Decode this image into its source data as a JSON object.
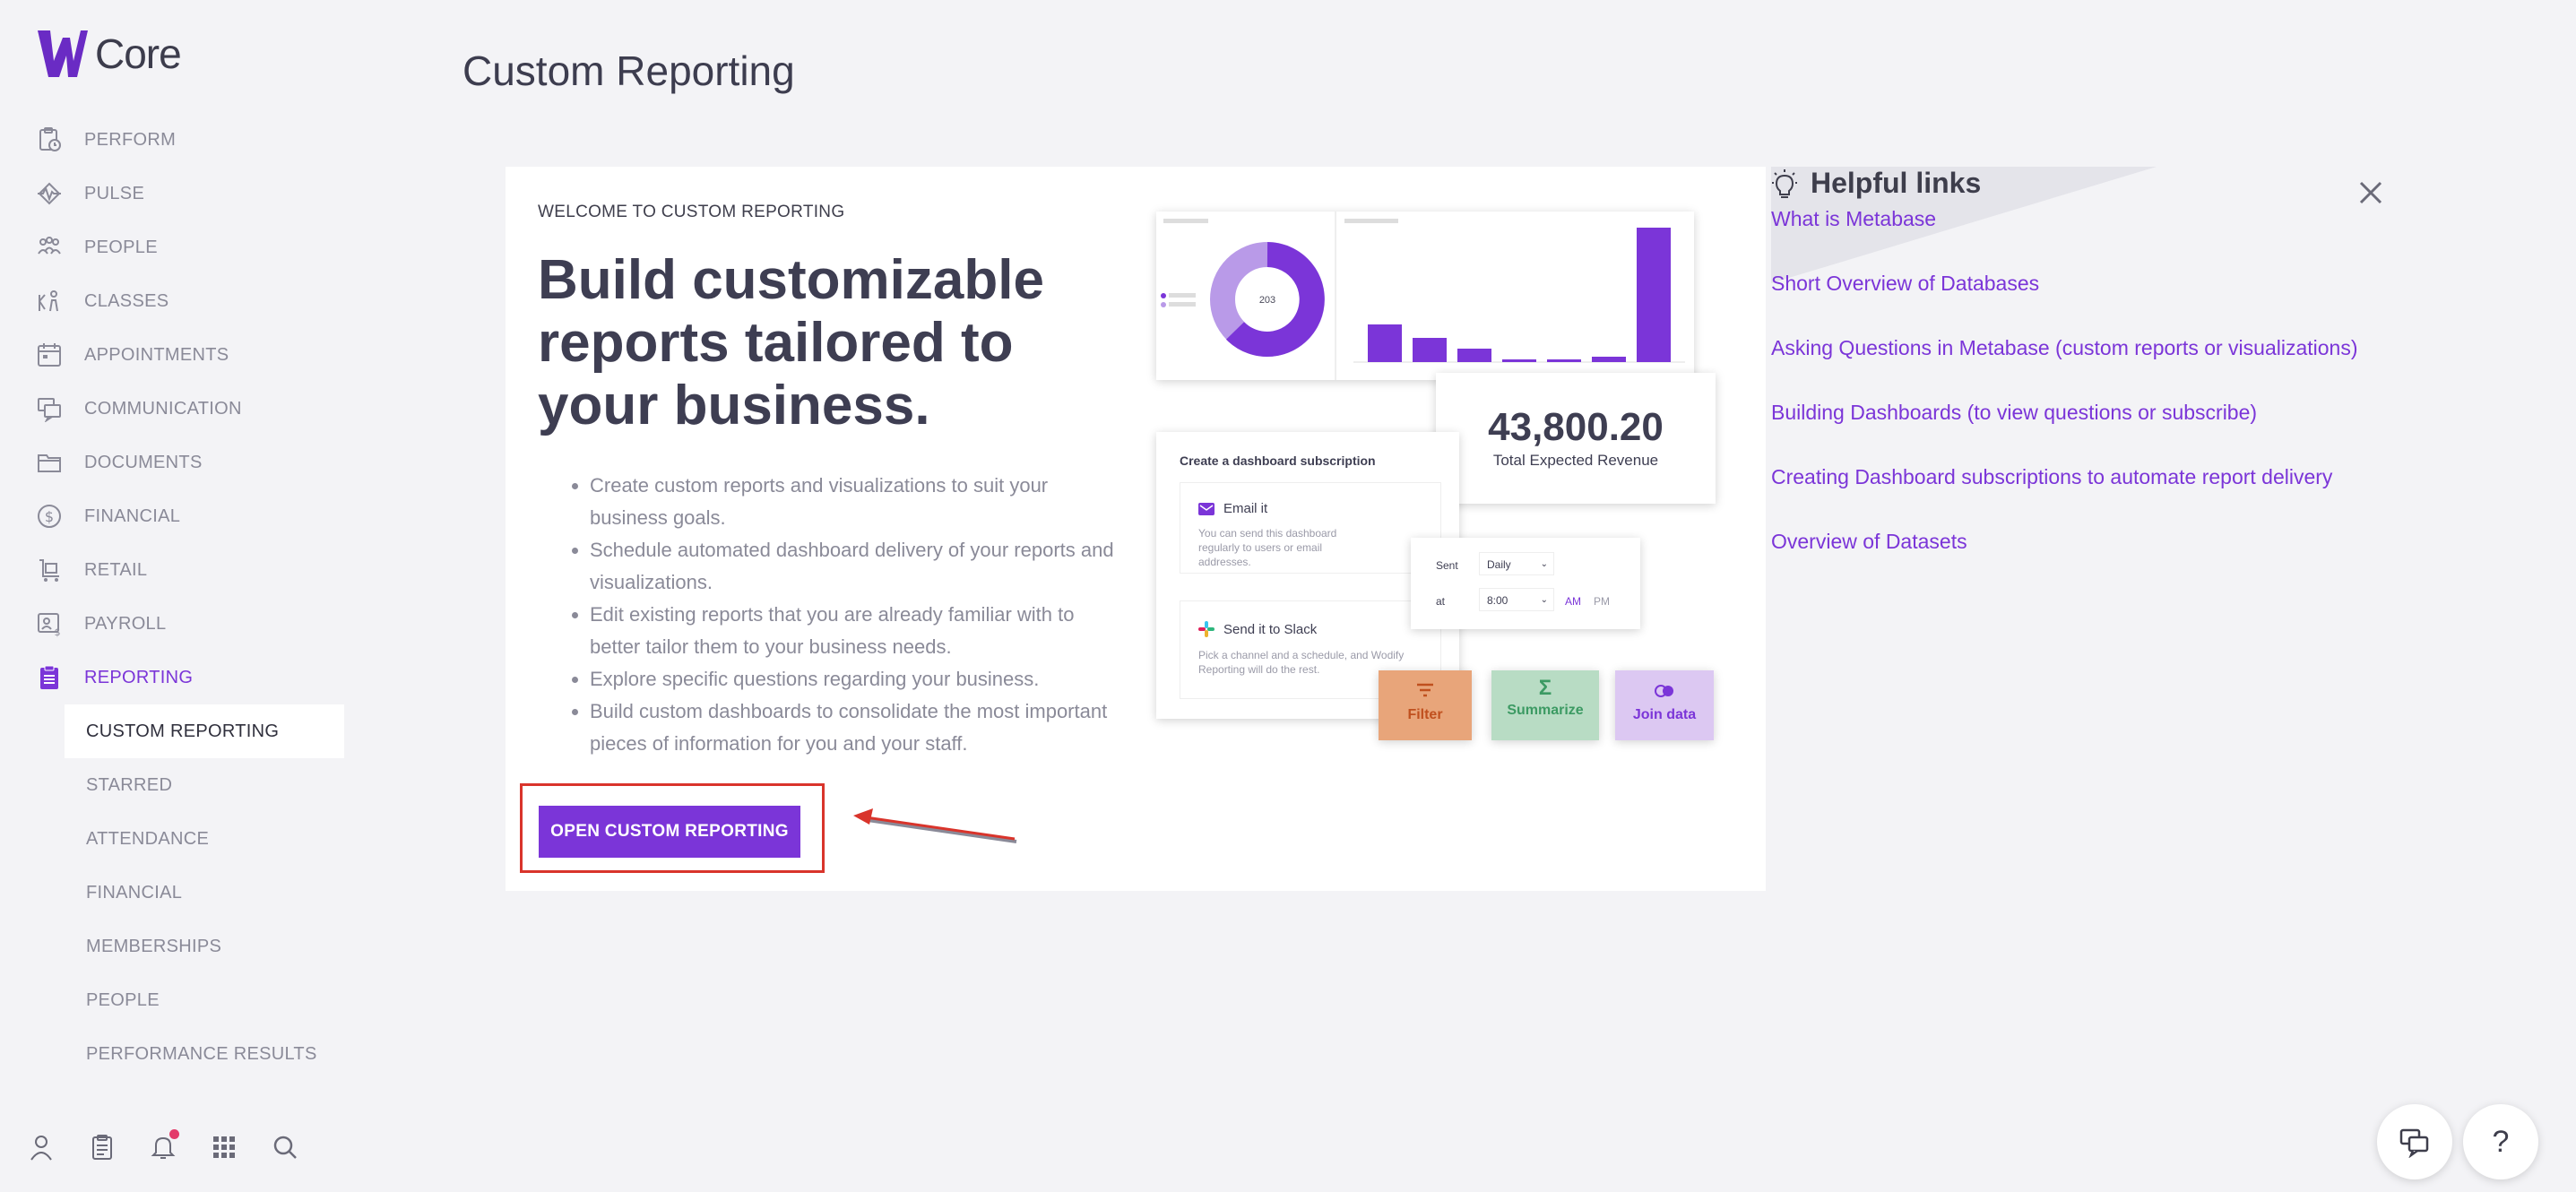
{
  "app": {
    "brand": "Core"
  },
  "sidebar": {
    "items": [
      {
        "label": "PERFORM",
        "icon": "clipboard-clock-icon"
      },
      {
        "label": "PULSE",
        "icon": "pulse-icon"
      },
      {
        "label": "PEOPLE",
        "icon": "people-icon"
      },
      {
        "label": "CLASSES",
        "icon": "classes-icon"
      },
      {
        "label": "APPOINTMENTS",
        "icon": "calendar-icon"
      },
      {
        "label": "COMMUNICATION",
        "icon": "chat-icon"
      },
      {
        "label": "DOCUMENTS",
        "icon": "folder-icon"
      },
      {
        "label": "FINANCIAL",
        "icon": "dollar-icon"
      },
      {
        "label": "RETAIL",
        "icon": "cart-icon"
      },
      {
        "label": "PAYROLL",
        "icon": "payroll-icon"
      },
      {
        "label": "REPORTING",
        "icon": "report-icon",
        "active": true
      }
    ],
    "subitems": [
      {
        "label": "CUSTOM REPORTING",
        "active": true
      },
      {
        "label": "STARRED"
      },
      {
        "label": "ATTENDANCE"
      },
      {
        "label": "FINANCIAL"
      },
      {
        "label": "MEMBERSHIPS"
      },
      {
        "label": "PEOPLE"
      },
      {
        "label": "PERFORMANCE RESULTS"
      }
    ]
  },
  "page": {
    "title": "Custom Reporting"
  },
  "welcome": {
    "eyebrow": "WELCOME TO CUSTOM REPORTING",
    "headline": "Build customizable reports tailored to your business.",
    "bullets": [
      "Create custom reports and visualizations to suit your business goals.",
      "Schedule automated dashboard delivery of your reports and visualizations.",
      "Edit existing reports that you are already familiar with to better tailor them to your business needs.",
      "Explore specific questions regarding your business.",
      "Build custom dashboards to consolidate the most important pieces of information for you and your staff."
    ],
    "cta_label": "OPEN CUSTOM REPORTING"
  },
  "illustration": {
    "donut_total": "203",
    "revenue_value": "43,800.20",
    "revenue_label": "Total Expected Revenue",
    "subscription_title": "Create a dashboard subscription",
    "email_title": "Email it",
    "email_text": "You can send this dashboard regularly to users or email addresses.",
    "slack_title": "Send it to Slack",
    "slack_text": "Pick a channel and a schedule, and Wodify Reporting will do the rest.",
    "sent_label": "Sent",
    "sent_value": "Daily",
    "at_label": "at",
    "at_value": "8:00",
    "am": "AM",
    "pm": "PM",
    "filter": "Filter",
    "summarize": "Summarize",
    "join": "Join data",
    "bars": [
      0.28,
      0.18,
      0.1,
      0.02,
      0.02,
      0.04,
      1.0
    ],
    "colors": {
      "purple": "#7b35d8",
      "light_purple": "#b99ae8",
      "filter_bg": "#e8a57a",
      "summarize_bg": "#b8dcc4",
      "join_bg": "#dcc8f2"
    }
  },
  "helpful": {
    "title": "Helpful links",
    "links": [
      "What is Metabase",
      "Short Overview of Databases",
      "Asking Questions in Metabase (custom reports or visualizations)",
      "Building Dashboards (to view questions or subscribe)",
      "Creating Dashboard subscriptions to automate report delivery",
      "Overview of Datasets"
    ]
  },
  "fab": {
    "help": "?"
  },
  "colors": {
    "accent": "#7b35d8",
    "highlight": "#d9342b",
    "bg": "#f3f3f6"
  }
}
